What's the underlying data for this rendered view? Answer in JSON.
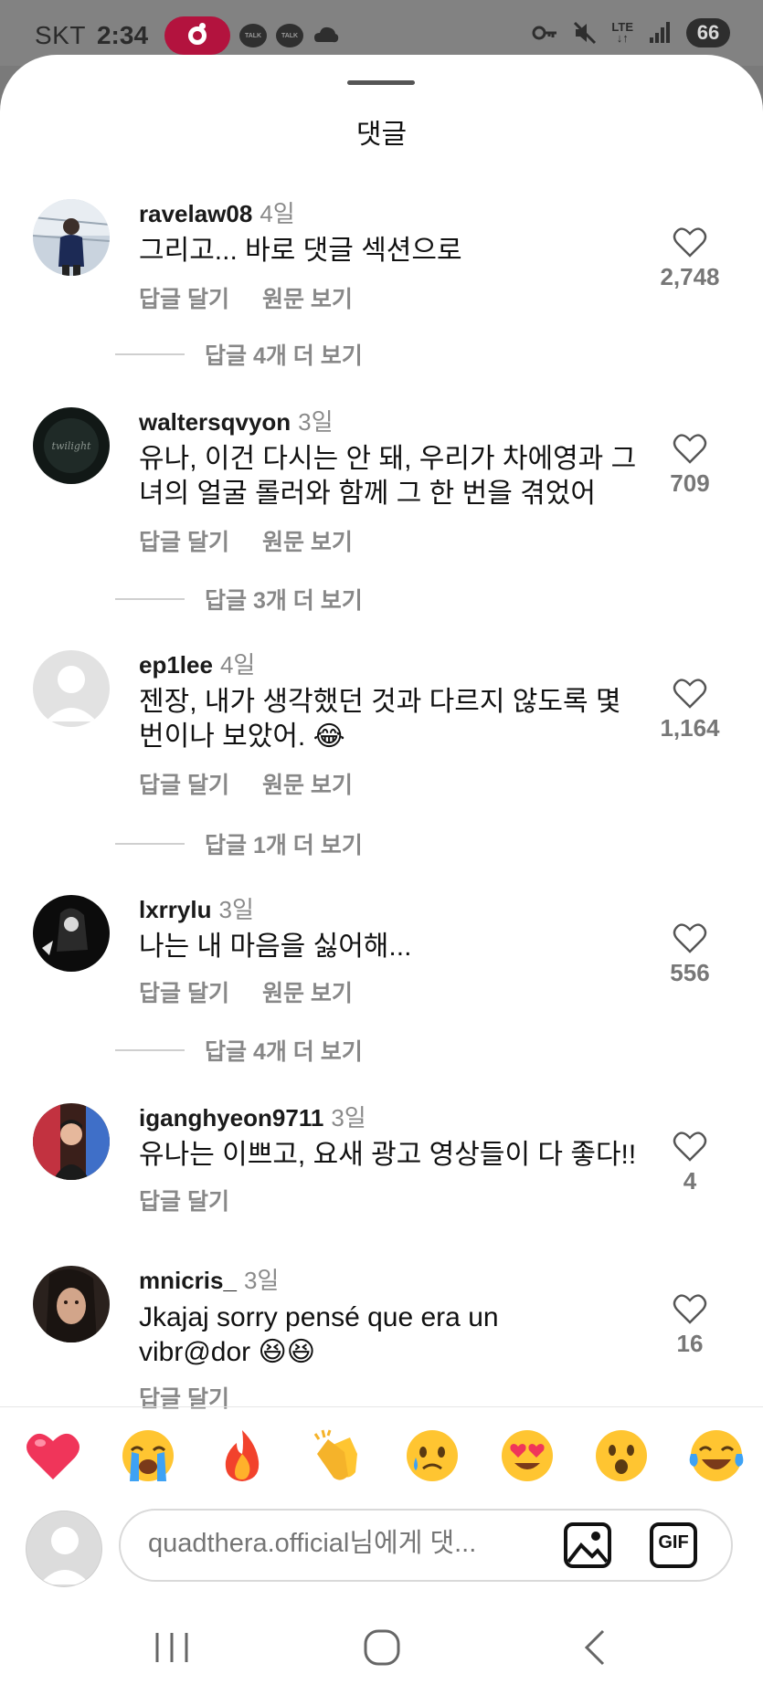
{
  "status_bar": {
    "carrier": "SKT",
    "time": "2:34",
    "talk_label": "TALK",
    "network": "LTE",
    "battery": "66"
  },
  "sheet": {
    "title": "댓글"
  },
  "labels": {
    "reply": "답글 달기",
    "see_original": "원문 보기"
  },
  "comments": [
    {
      "username": "ravelaw08",
      "time": "4일",
      "text": "그리고... 바로 댓글 섹션으로",
      "likes": "2,748",
      "more_replies": "답글 4개 더 보기"
    },
    {
      "username": "waltersqvyon",
      "time": "3일",
      "text": "유나, 이건 다시는 안 돼, 우리가 차에영과 그녀의 얼굴 롤러와 함께 그 한 번을 겪었어",
      "likes": "709",
      "more_replies": "답글 3개 더 보기"
    },
    {
      "username": "ep1lee",
      "time": "4일",
      "text": "젠장, 내가 생각했던 것과 다르지 않도록 몇 번이나 보았어. 😂",
      "likes": "1,164",
      "more_replies": "답글 1개 더 보기"
    },
    {
      "username": "lxrrylu",
      "time": "3일",
      "text": "나는 내 마음을 싫어해...",
      "likes": "556",
      "more_replies": "답글 4개 더 보기"
    },
    {
      "username": "iganghyeon9711",
      "time": "3일",
      "text": "유나는 이쁘고, 요새 광고 영상들이 다 좋다!!",
      "likes": "4"
    },
    {
      "username": "mnicris_",
      "time": "3일",
      "text": "Jkajaj sorry pensé que era un vibr@dor 😆😆",
      "likes": "16"
    }
  ],
  "emoji_bar": [
    "heart",
    "loudly-crying",
    "fire",
    "clapping-hands",
    "crying",
    "heart-eyes",
    "surprised",
    "tears-of-joy"
  ],
  "input": {
    "placeholder": "quadthera.official님에게 댓...",
    "gif_label": "GIF"
  },
  "colors": {
    "accent": "#b3133e",
    "muted_text": "#888888"
  }
}
